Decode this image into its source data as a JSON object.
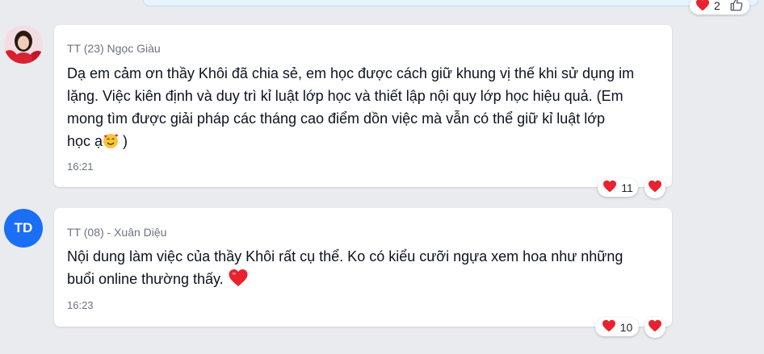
{
  "previous_message": {
    "reaction_count": "2"
  },
  "messages": [
    {
      "avatar_kind": "photo",
      "sender": "TT (23) Ngọc Giàu",
      "text_lines": [
        "Dạ em cảm ơn thầy Khôi đã chia sẻ, em học được cách giữ khung vị thế khi sử dụng im",
        "lặng. Việc kiên định và duy trì kỉ luật lớp học và thiết lập nội quy lớp học hiệu quả. (Em",
        "mong tìm được giải pháp các tháng cao điểm dồn việc mà vẫn có thể giữ kỉ luật lớp"
      ],
      "last_line_before": "học ạ",
      "last_line_after": " )",
      "inline_emoji": "smiling-face-with-hearts",
      "time": "16:21",
      "reaction_icon": "heart",
      "reaction_count": "11"
    },
    {
      "avatar_initials": "TD",
      "avatar_color": "#1a6ff4",
      "sender": "TT (08) - Xuân Diệu",
      "text_lines": [
        "Nội dung làm việc của thầy Khôi rất cụ thể. Ko có kiểu cưỡi ngựa xem hoa như những"
      ],
      "last_line_before": "buổi online thường thấy. ",
      "inline_emoji": "heart",
      "time": "16:23",
      "reaction_icon": "heart",
      "reaction_count": "10"
    }
  ],
  "colors": {
    "background": "#e9ebef",
    "card": "#ffffff",
    "heart": "#e8222f",
    "avatar_td": "#1a6ff4",
    "meta_text": "#6b7280"
  }
}
